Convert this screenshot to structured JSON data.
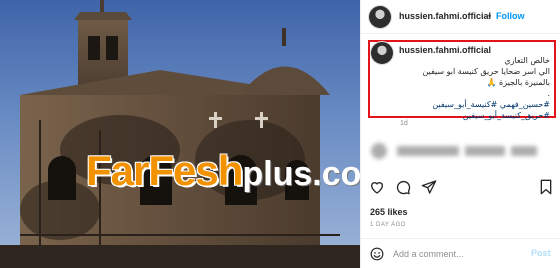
{
  "photo": {
    "watermark_main": "FarFesh",
    "watermark_tail": "plus.com"
  },
  "post": {
    "username": "hussien.fahmi.official",
    "separator": "•",
    "follow_label": "Follow",
    "caption_username": "hussien.fahmi.official",
    "caption_lines": [
      "خالص التعازي",
      "الي اسر ضحايا حريق كنيسة ابو سيفين",
      "بالمنيرة بالجيزة 🙏",
      ".",
      "#حسين_فهمي #كنيسة_أبو_سيفين",
      "#حريق_كنيسة_أبو_سيفين"
    ],
    "caption_time": "1d",
    "likes": "265 likes",
    "date": "1 DAY AGO",
    "comment_placeholder": "Add a comment...",
    "post_label": "Post"
  },
  "colors": {
    "follow": "#0095f6",
    "highlight_box": "#e3131b",
    "watermark": "#f39200"
  },
  "icons": [
    "heart-icon",
    "comment-icon",
    "share-icon",
    "bookmark-icon",
    "emoji-icon"
  ]
}
